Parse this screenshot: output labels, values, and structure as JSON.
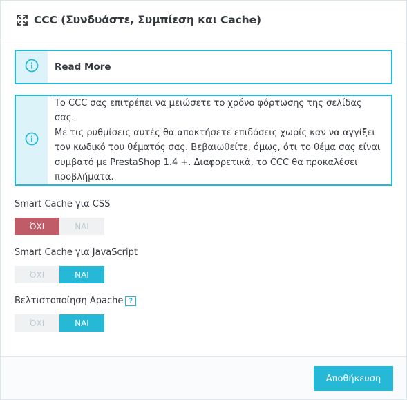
{
  "panel": {
    "title": "CCC (Συνδυάστε, Συμπίεση και Cache)",
    "title_icon": "expand-arrows-icon"
  },
  "alerts": {
    "read_more": {
      "text": "Read More",
      "icon": "info-circle-icon"
    },
    "info": {
      "icon": "info-circle-icon",
      "lines": [
        "Το CCC σας επιτρέπει να μειώσετε το χρόνο φόρτωσης της σελίδας σας.",
        "Με τις ρυθμίσεις αυτές θα αποκτήσετε επιδόσεις χωρίς καν να αγγίξει",
        "τον κωδικό του θέματός σας. Βεβαιωθείτε, όμως, ότι το θέμα σας είναι",
        "συμβατό με PrestaShop 1.4 +. Διαφορετικά, το CCC θα προκαλέσει",
        "προβλήματα."
      ]
    }
  },
  "settings": [
    {
      "label": "Smart Cache για CSS",
      "no": "ΌΧΙ",
      "yes": "ΝΑΙ",
      "selected": "no"
    },
    {
      "label": "Smart Cache για JavaScript",
      "no": "ΌΧΙ",
      "yes": "ΝΑΙ",
      "selected": "yes"
    },
    {
      "label": "Βελτιστοποίηση Apache",
      "help": "?",
      "no": "ΌΧΙ",
      "yes": "ΝΑΙ",
      "selected": "yes"
    }
  ],
  "footer": {
    "save_label": "Αποθήκευση"
  },
  "colors": {
    "accent": "#25b9d7",
    "danger": "#c05c67",
    "alert_icon_bg": "#dcf4f9"
  }
}
